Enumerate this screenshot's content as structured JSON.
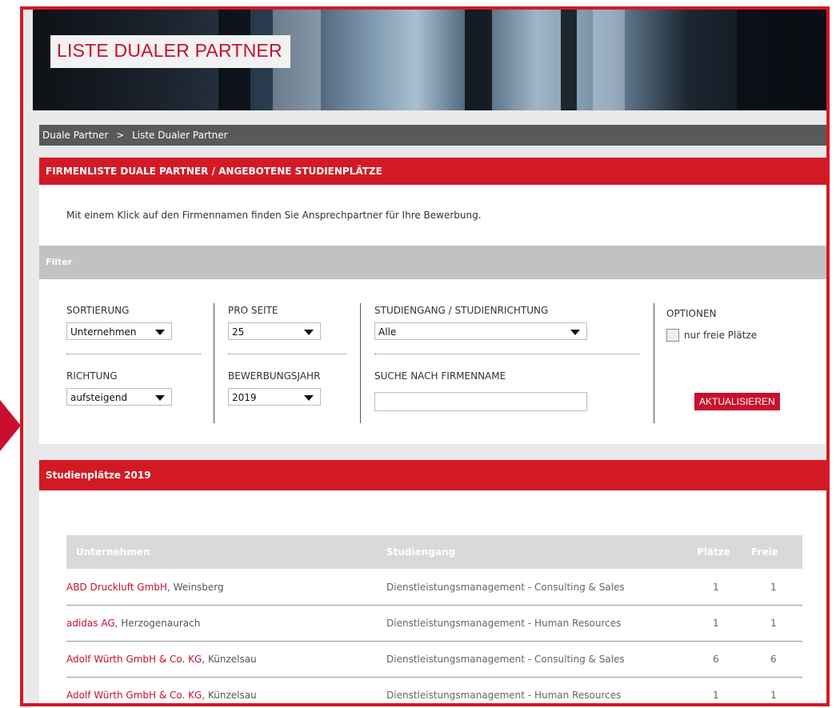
{
  "hero": {
    "title": "LISTE DUALER PARTNER"
  },
  "breadcrumb": {
    "item1": "Duale Partner",
    "separator": ">",
    "item2": "Liste Dualer Partner"
  },
  "section1": {
    "title": "FIRMENLISTE DUALE PARTNER / ANGEBOTENE STUDIENPLÄTZE",
    "intro": "Mit einem Klick auf den Firmennamen finden Sie Ansprechpartner für Ihre Bewerbung."
  },
  "filter": {
    "title": "Filter",
    "sortierung_label": "SORTIERUNG",
    "sortierung_value": "Unternehmen",
    "pro_seite_label": "PRO SEITE",
    "pro_seite_value": "25",
    "studiengang_label": "STUDIENGANG / STUDIENRICHTUNG",
    "studiengang_value": "Alle",
    "optionen_label": "OPTIONEN",
    "nur_freie_label": "nur freie Plätze",
    "richtung_label": "RICHTUNG",
    "richtung_value": "aufsteigend",
    "bewerbungsjahr_label": "BEWERBUNGSJAHR",
    "bewerbungsjahr_value": "2019",
    "suche_label": "SUCHE NACH FIRMENNAME",
    "suche_value": "",
    "aktualisieren": "AKTUALISIEREN"
  },
  "results": {
    "title": "Studienplätze 2019",
    "columns": {
      "unternehmen": "Unternehmen",
      "studiengang": "Studiengang",
      "plaetze": "Plätze",
      "freie": "Freie"
    },
    "rows": [
      {
        "firm": "ABD Druckluft GmbH",
        "city": ", Weinsberg",
        "studiengang": "Dienstleistungsmanagement - Consulting & Sales",
        "plaetze": "1",
        "freie": "1"
      },
      {
        "firm": "adidas AG",
        "city": ", Herzogenaurach",
        "studiengang": "Dienstleistungsmanagement - Human Resources",
        "plaetze": "1",
        "freie": "1"
      },
      {
        "firm": "Adolf Würth GmbH & Co. KG",
        "city": ", Künzelsau",
        "studiengang": "Dienstleistungsmanagement - Consulting & Sales",
        "plaetze": "6",
        "freie": "6"
      },
      {
        "firm": "Adolf Würth GmbH & Co. KG",
        "city": ", Künzelsau",
        "studiengang": "Dienstleistungsmanagement - Human Resources",
        "plaetze": "1",
        "freie": "1"
      }
    ]
  },
  "colors": {
    "accent": "#d21a25",
    "breadcrumb_bg": "#595959",
    "filter_bg": "#c2c2c2"
  },
  "icons": {
    "dropdown": "chevron-down-icon",
    "checkbox": "checkbox-icon",
    "arrow": "arrow-right-icon"
  }
}
